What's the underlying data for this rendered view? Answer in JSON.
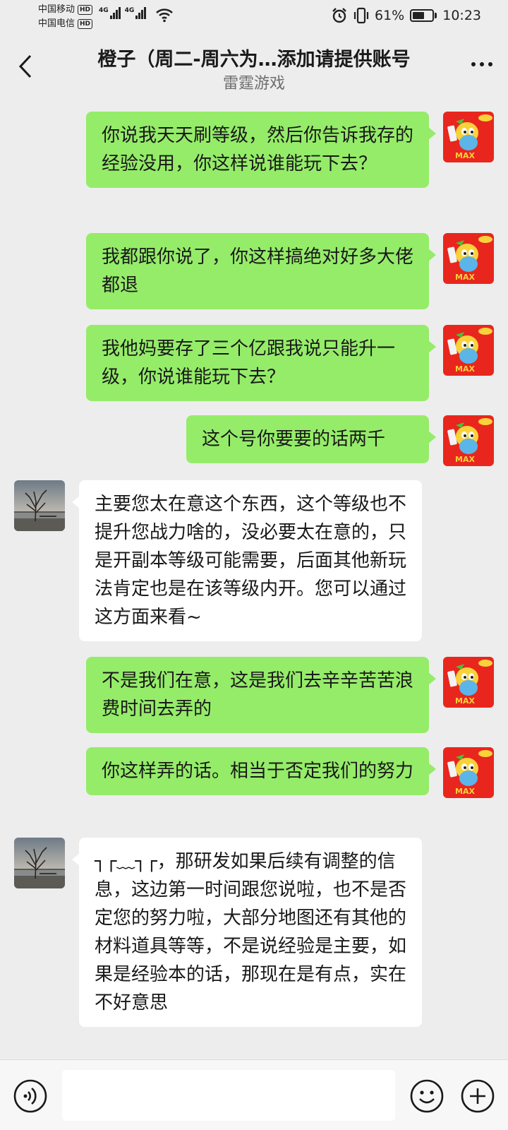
{
  "status_bar": {
    "carrier_1": "中国移动",
    "carrier_2": "中国电信",
    "hd": "HD",
    "network": "4G",
    "battery_percent": "61%",
    "battery_level": 0.61,
    "time": "10:23"
  },
  "header": {
    "title": "橙子（周二-周六为…添加请提供账号",
    "subtitle": "雷霆游戏"
  },
  "messages": [
    {
      "side": "out",
      "text": "你说我天天刷等级，然后你告诉我存的经验没用，你这样说谁能玩下去？"
    },
    {
      "side": "out",
      "text": "我都跟你说了，你这样搞绝对好多大佬都退"
    },
    {
      "side": "out",
      "text": "我他妈要存了三个亿跟我说只能升一级，你说谁能玩下去？"
    },
    {
      "side": "out",
      "text": "这个号你要要的话两千"
    },
    {
      "side": "in",
      "text": "主要您太在意这个东西，这个等级也不提升您战力啥的，没必要太在意的，只是开副本等级可能需要，后面其他新玩法肯定也是在该等级内开。您可以通过这方面来看~"
    },
    {
      "side": "out",
      "text": "不是我们在意，这是我们去辛辛苦苦浪费时间去弄的"
    },
    {
      "side": "out",
      "text": "你这样弄的话。相当于否定我们的努力"
    },
    {
      "side": "in",
      "text": "┐┌﹏┐┌，那研发如果后续有调整的信息，这边第一时间跟您说啦，也不是否定您的努力啦，大部分地图还有其他的材料道具等等，不是说经验是主要，如果是经验本的话，那现在是有点，实在不好意思"
    }
  ],
  "avatar_self_text": "MAX",
  "input": {
    "placeholder": ""
  },
  "colors": {
    "background": "#ededed",
    "bubble_out": "#95ec69",
    "bubble_in": "#ffffff"
  },
  "icons": [
    "back-icon",
    "more-icon",
    "voice-icon",
    "emoji-icon",
    "plus-icon",
    "wifi-icon",
    "alarm-icon",
    "vibrate-icon",
    "battery-icon"
  ]
}
